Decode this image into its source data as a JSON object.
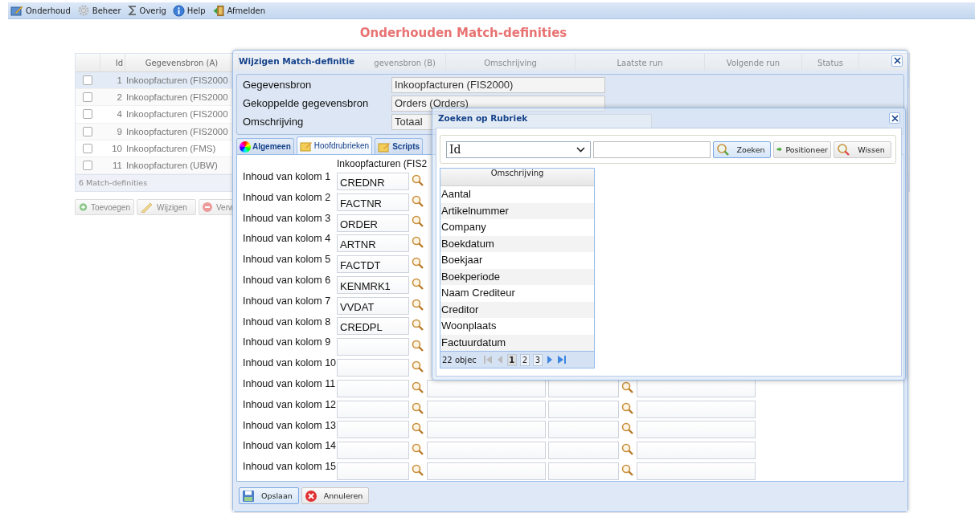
{
  "menu": [
    {
      "label": "Onderhoud"
    },
    {
      "label": "Beheer"
    },
    {
      "label": "Overig"
    },
    {
      "label": "Help"
    },
    {
      "label": "Afmelden"
    }
  ],
  "page_title": "Onderhouden Match-definities",
  "grid": {
    "columns": [
      "Id",
      "Gegevensbron (A)",
      "gevensbron (B)",
      "Omschrijving",
      "Laatste run",
      "Volgende run",
      "Status"
    ],
    "rows": [
      {
        "id": "1",
        "source": "Inkoopfacturen (FIS2000",
        "selected": true,
        "checked": false
      },
      {
        "id": "2",
        "source": "Inkoopfacturen (FIS2000",
        "selected": false,
        "checked": false
      },
      {
        "id": "4",
        "source": "Inkoopfacturen (FIS2000",
        "selected": false,
        "checked": false
      },
      {
        "id": "9",
        "source": "Inkoopfacturen (FIS2000",
        "selected": false,
        "checked": false
      },
      {
        "id": "10",
        "source": "Inkoopfacturen (FMS)",
        "selected": false,
        "checked": false
      },
      {
        "id": "11",
        "source": "Inkoopfacturen (UBW)",
        "selected": false,
        "checked": false
      }
    ],
    "footer": "6 Match-definities",
    "buttons": [
      {
        "label": "Toevoegen"
      },
      {
        "label": "Wijzigen"
      },
      {
        "label": "Verw"
      }
    ]
  },
  "edit_dialog": {
    "title": "Wijzigen Match-definitie",
    "fields": [
      {
        "label": "Gegevensbron",
        "value": "Inkoopfacturen (FIS2000)"
      },
      {
        "label": "Gekoppelde gegevensbron",
        "value": "Orders (Orders)"
      },
      {
        "label": "Omschrijving",
        "value": "Totaal"
      }
    ],
    "tabs": [
      {
        "label": "Algemeen",
        "selected": false
      },
      {
        "label": "Hoofdrubrieken",
        "selected": true
      },
      {
        "label": "Scripts",
        "selected": false
      }
    ],
    "column_header": "Inkoopfacturen (FIS2",
    "rows": [
      {
        "label": "Inhoud van kolom 1",
        "kind": "partial",
        "value": "CREDNR"
      },
      {
        "label": "Inhoud van kolom 2",
        "kind": "partial",
        "value": "FACTNR"
      },
      {
        "label": "Inhoud van kolom 3",
        "kind": "partial",
        "value": "ORDER"
      },
      {
        "label": "Inhoud van kolom 4",
        "kind": "partial",
        "value": "ARTNR"
      },
      {
        "label": "Inhoud van kolom 5",
        "kind": "partial",
        "value": "FACTDT"
      },
      {
        "label": "Inhoud van kolom 6",
        "kind": "partial",
        "value": "KENMRK1"
      },
      {
        "label": "Inhoud van kolom 7",
        "kind": "partial",
        "value": "VVDAT"
      },
      {
        "label": "Inhoud van kolom 8",
        "kind": "partial",
        "value": "CREDPL"
      },
      {
        "label": "Inhoud van kolom 9",
        "kind": "partial"
      },
      {
        "label": "Inhoud van kolom 10",
        "kind": "partial"
      },
      {
        "label": "Inhoud van kolom 11",
        "kind": "full"
      },
      {
        "label": "Inhoud van kolom 12",
        "kind": "full"
      },
      {
        "label": "Inhoud van kolom 13",
        "kind": "full"
      },
      {
        "label": "Inhoud van kolom 14",
        "kind": "full"
      },
      {
        "label": "Inhoud van kolom 15",
        "kind": "full"
      }
    ],
    "buttons": [
      {
        "label": "Opslaan",
        "focused": true
      },
      {
        "label": "Annuleren",
        "focused": false
      }
    ]
  },
  "search_dialog": {
    "title": "Zoeken op Rubriek",
    "select": "Id",
    "buttons": [
      {
        "label": "Zoeken",
        "focused": true
      },
      {
        "label": "Positioneer",
        "focused": false
      },
      {
        "label": "Wissen",
        "focused": false
      }
    ],
    "results_header": "Omschrijving",
    "results": [
      "Aantal",
      "Artikelnummer",
      "Company",
      "Boekdatum",
      "Boekjaar",
      "Boekperiode",
      "Naam Crediteur",
      "Creditor",
      "Woonplaats",
      "Factuurdatum"
    ],
    "pager": {
      "count": "22 objec",
      "pages": [
        {
          "label": "1",
          "selected": true
        },
        {
          "label": "2",
          "selected": false
        },
        {
          "label": "3",
          "selected": false
        }
      ]
    }
  }
}
